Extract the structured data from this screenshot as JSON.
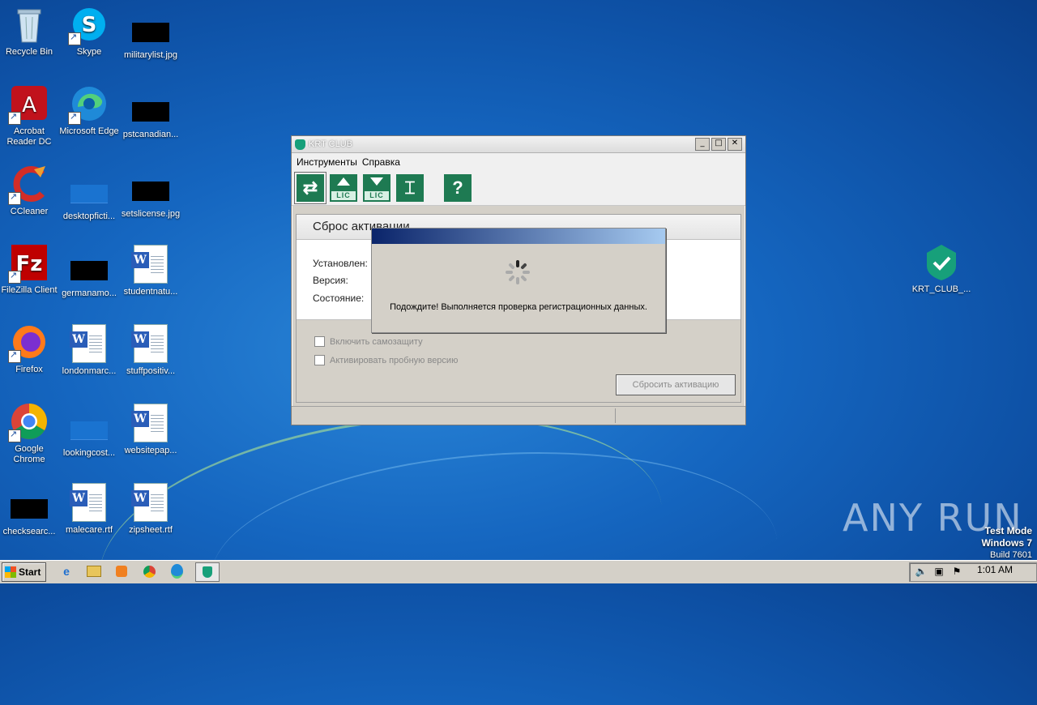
{
  "desktop": {
    "icons_col1": [
      {
        "label": "Recycle Bin",
        "icon": "recycle-bin-icon"
      },
      {
        "label": "Acrobat Reader DC",
        "icon": "acrobat-icon"
      },
      {
        "label": "CCleaner",
        "icon": "ccleaner-icon"
      },
      {
        "label": "FileZilla Client",
        "icon": "filezilla-icon"
      },
      {
        "label": "Firefox",
        "icon": "firefox-icon"
      },
      {
        "label": "Google Chrome",
        "icon": "chrome-icon"
      },
      {
        "label": "checksearc...",
        "icon": "black-thumb"
      }
    ],
    "icons_col2": [
      {
        "label": "Skype",
        "icon": "skype-icon"
      },
      {
        "label": "Microsoft Edge",
        "icon": "edge-icon"
      },
      {
        "label": "desktopficti...",
        "icon": "blue-thumb"
      },
      {
        "label": "germanamo...",
        "icon": "black-thumb"
      },
      {
        "label": "londonmarc...",
        "icon": "word-icon"
      },
      {
        "label": "lookingcost...",
        "icon": "blue-thumb"
      },
      {
        "label": "malecare.rtf",
        "icon": "word-icon"
      }
    ],
    "icons_col3": [
      {
        "label": "militarylist.jpg",
        "icon": "black-thumb"
      },
      {
        "label": "pstcanadian...",
        "icon": "black-thumb"
      },
      {
        "label": "setslicense.jpg",
        "icon": "black-thumb"
      },
      {
        "label": "studentnatu...",
        "icon": "word-icon"
      },
      {
        "label": "stuffpositiv...",
        "icon": "word-icon"
      },
      {
        "label": "websitepap...",
        "icon": "word-icon"
      },
      {
        "label": "zipsheet.rtf",
        "icon": "word-icon"
      }
    ],
    "right_icon": {
      "label": "KRT_CLUB_...",
      "icon": "shield-check-icon"
    }
  },
  "window": {
    "title": "KRT CLUB",
    "menu": [
      "Инструменты",
      "Справка"
    ],
    "toolbar": [
      {
        "name": "reset-activation-tool",
        "glyph": "⇄"
      },
      {
        "name": "upload-license-tool",
        "glyph": "LIC"
      },
      {
        "name": "download-license-tool",
        "glyph": "LIC"
      },
      {
        "name": "clean-tool",
        "glyph": "⌶"
      },
      {
        "name": "help-tool",
        "glyph": "?"
      }
    ],
    "panel": {
      "header": "Сброс активации",
      "rows": [
        "Установлен:",
        "Версия:",
        "Состояние:"
      ],
      "checkboxes": [
        "Включить самозащиту",
        "Активировать пробную версию"
      ],
      "reset_button": "Сбросить активацию"
    }
  },
  "dialog": {
    "message": "Подождите! Выполняется проверка регистрационных данных."
  },
  "watermark": {
    "text": "ANY RUN"
  },
  "testmode": {
    "line1": "Test Mode",
    "line2": "Windows 7",
    "line3": "Build 7601"
  },
  "taskbar": {
    "start_label": "Start",
    "clock": "1:01 AM"
  }
}
